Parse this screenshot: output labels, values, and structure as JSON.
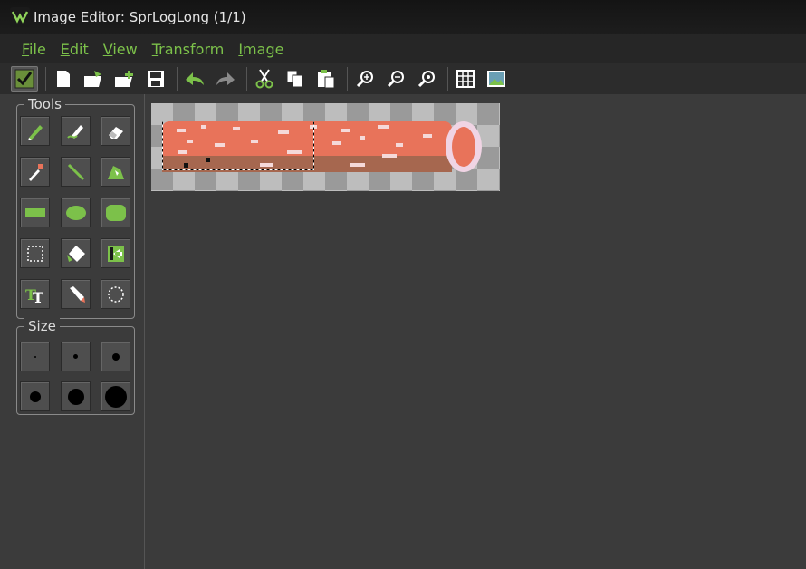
{
  "window": {
    "title": "Image Editor: SprLogLong (1/1)"
  },
  "menu": {
    "items": [
      {
        "label": "File"
      },
      {
        "label": "Edit"
      },
      {
        "label": "View"
      },
      {
        "label": "Transform"
      },
      {
        "label": "Image"
      }
    ]
  },
  "toolbar": {
    "buttons": [
      "confirm-icon",
      "new-file-icon",
      "open-file-icon",
      "add-file-icon",
      "save-icon",
      "undo-icon",
      "redo-icon",
      "cut-icon",
      "copy-icon",
      "paste-icon",
      "zoom-in-icon",
      "zoom-out-icon",
      "zoom-reset-icon",
      "grid-icon",
      "image-icon"
    ]
  },
  "tools_panel": {
    "label": "Tools"
  },
  "size_panel": {
    "label": "Size"
  },
  "colors": {
    "accent": "#7cc14a",
    "log": "#e8735a",
    "log_shadow": "#a6674f",
    "highlight": "#f5d9d9"
  }
}
